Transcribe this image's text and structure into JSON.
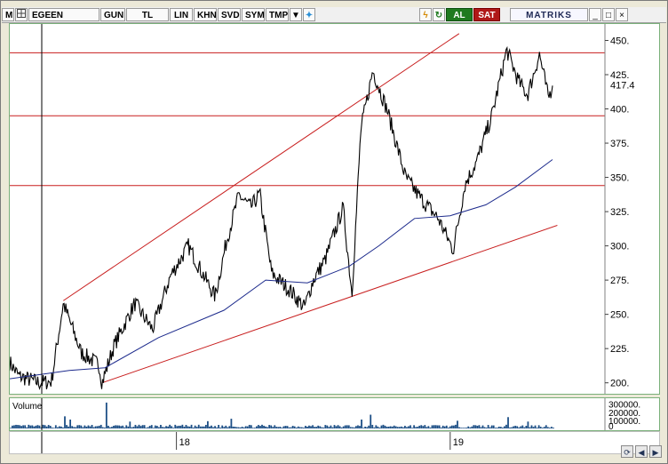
{
  "toolbar": {
    "menu_label": "M",
    "symbol": "EGEEN",
    "buttons": [
      "GUN",
      "TL",
      "LIN",
      "KHN",
      "SVD",
      "SYM",
      "TMP"
    ],
    "buy_label": "AL",
    "sell_label": "SAT",
    "brand": "MATRIKS"
  },
  "chart_data": {
    "type": "line",
    "symbol": "EGEEN",
    "y_ticks": [
      200,
      225,
      250,
      275,
      300,
      325,
      350,
      375,
      400,
      425,
      450
    ],
    "ylim": [
      192,
      462
    ],
    "last_value_label": "417.4",
    "last_value": 417.4,
    "x_tick_labels": [
      "18",
      "19"
    ],
    "x_tick_positions": [
      0.28,
      0.74
    ],
    "price_keypoints": [
      [
        0.0,
        215
      ],
      [
        0.015,
        205
      ],
      [
        0.05,
        200
      ],
      [
        0.07,
        201
      ],
      [
        0.09,
        258
      ],
      [
        0.12,
        222
      ],
      [
        0.15,
        213
      ],
      [
        0.155,
        200
      ],
      [
        0.175,
        227
      ],
      [
        0.21,
        258
      ],
      [
        0.24,
        239
      ],
      [
        0.27,
        278
      ],
      [
        0.3,
        300
      ],
      [
        0.32,
        283
      ],
      [
        0.345,
        263
      ],
      [
        0.365,
        305
      ],
      [
        0.385,
        337
      ],
      [
        0.405,
        328
      ],
      [
        0.42,
        338
      ],
      [
        0.44,
        280
      ],
      [
        0.47,
        268
      ],
      [
        0.495,
        255
      ],
      [
        0.51,
        275
      ],
      [
        0.53,
        290
      ],
      [
        0.56,
        328
      ],
      [
        0.575,
        265
      ],
      [
        0.59,
        385
      ],
      [
        0.61,
        428
      ],
      [
        0.635,
        398
      ],
      [
        0.665,
        350
      ],
      [
        0.69,
        335
      ],
      [
        0.72,
        320
      ],
      [
        0.745,
        297
      ],
      [
        0.765,
        345
      ],
      [
        0.785,
        362
      ],
      [
        0.81,
        395
      ],
      [
        0.835,
        443
      ],
      [
        0.855,
        420
      ],
      [
        0.87,
        410
      ],
      [
        0.89,
        440
      ],
      [
        0.905,
        408
      ],
      [
        0.912,
        417
      ]
    ],
    "moving_average_keypoints": [
      [
        0.0,
        203
      ],
      [
        0.1,
        209
      ],
      [
        0.16,
        211
      ],
      [
        0.25,
        233
      ],
      [
        0.36,
        253
      ],
      [
        0.43,
        275
      ],
      [
        0.5,
        273
      ],
      [
        0.57,
        285
      ],
      [
        0.62,
        300
      ],
      [
        0.68,
        320
      ],
      [
        0.74,
        322
      ],
      [
        0.8,
        330
      ],
      [
        0.85,
        343
      ],
      [
        0.912,
        363
      ]
    ],
    "horizontal_levels": [
      441,
      395,
      344
    ],
    "trend_lines": [
      {
        "from": [
          0.09,
          260
        ],
        "to": [
          0.755,
          455
        ]
      },
      {
        "from": [
          0.155,
          200
        ],
        "to": [
          0.92,
          315
        ]
      }
    ],
    "volume": {
      "label": "Volume",
      "ticks": [
        "300000.",
        "200000.",
        "100000.",
        "0"
      ],
      "max": 330000,
      "spikes": [
        [
          0.09,
          150000
        ],
        [
          0.1,
          110000
        ],
        [
          0.16,
          320000
        ],
        [
          0.2,
          85000
        ],
        [
          0.33,
          90000
        ],
        [
          0.37,
          120000
        ],
        [
          0.59,
          110000
        ],
        [
          0.605,
          170000
        ],
        [
          0.75,
          95000
        ],
        [
          0.835,
          140000
        ],
        [
          0.87,
          85000
        ]
      ]
    },
    "colors": {
      "price": "#000000",
      "moving_average": "#1c2a8c",
      "levels": "#c81e1e",
      "trend": "#c81e1e",
      "volume": "#1d4f86",
      "cursor": "#000000"
    }
  }
}
